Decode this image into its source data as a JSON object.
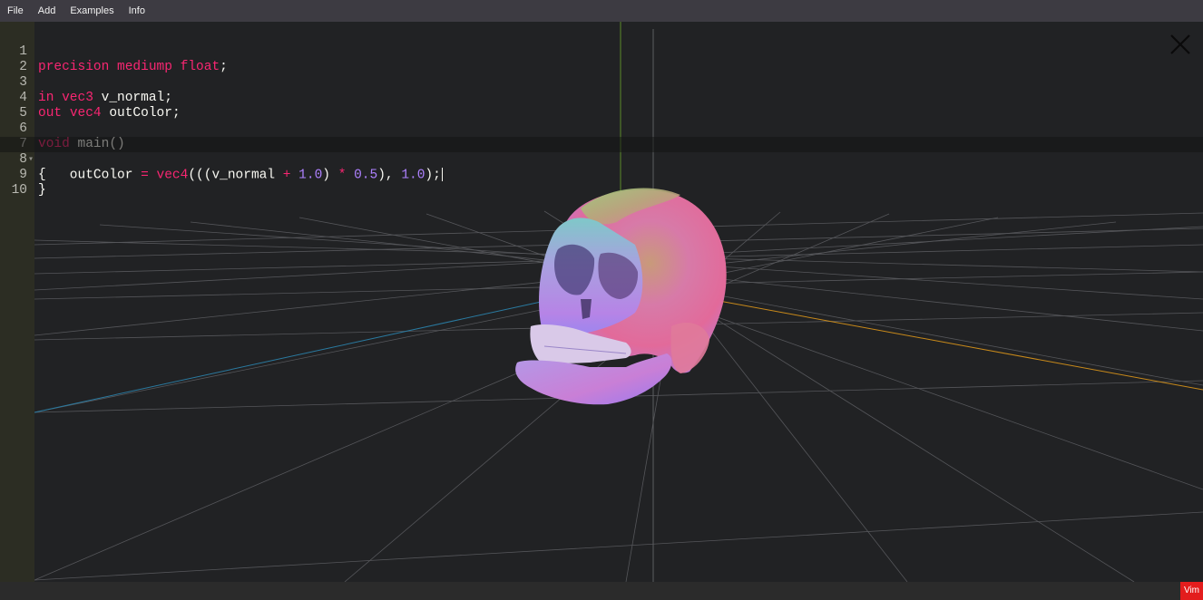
{
  "menu": {
    "items": [
      "File",
      "Add",
      "Examples",
      "Info"
    ]
  },
  "editor": {
    "lines": [
      {
        "number": "1",
        "text": "precision mediump float;"
      },
      {
        "number": "2",
        "text": ""
      },
      {
        "number": "3",
        "text": "in vec3 v_normal;"
      },
      {
        "number": "4",
        "text": "out vec4 outColor;"
      },
      {
        "number": "5",
        "text": ""
      },
      {
        "number": "6",
        "text": "void main()"
      },
      {
        "number": "7",
        "text": "{"
      },
      {
        "number": "8",
        "text": "    outColor = vec4(((v_normal + 1.0) * 0.5), 1.0);"
      },
      {
        "number": "9",
        "text": "}"
      },
      {
        "number": "10",
        "text": ""
      }
    ],
    "active_line": "8",
    "fold_marker_line": "7"
  },
  "status": {
    "mode_badge": "Vim"
  },
  "icons": {
    "close": "close-icon",
    "fold": "fold-arrow-icon"
  },
  "colors": {
    "menubar": "#3d3b42",
    "viewport": "#212224",
    "gutter": "#2c2d23",
    "keyword": "#f92672",
    "number": "#ae81ff",
    "vim_badge": "#e31d1d",
    "axis_x": "#c98a1a",
    "axis_y": "#5a8a2a",
    "axis_z": "#2a7aa0"
  }
}
